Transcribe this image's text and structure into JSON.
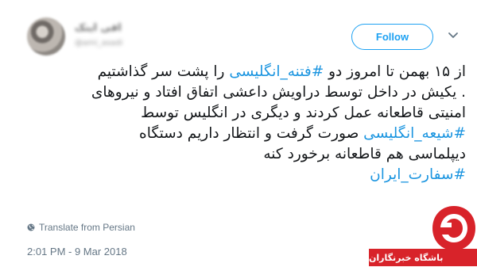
{
  "author": {
    "display_name": "افی اینک",
    "handle": "@ami_asadi",
    "avatar_icon": "user-avatar"
  },
  "header": {
    "follow_label": "Follow",
    "more_icon": "chevron-down-icon"
  },
  "tweet": {
    "line1_pre": "از ۱۵ بهمن تا امروز دو ",
    "line1_tag": "#فتنه_انگلیسی",
    "line1_post": " را پشت سر گذاشتیم",
    "line2": ". یکیش در داخل توسط دراویش داعشی اتفاق افتاد و نیروهای",
    "line3": "امنیتی قاطعانه عمل کردند و دیگری در انگلیس توسط",
    "line4_tag": "#شیعه_انگلیسی",
    "line4_post": " صورت گرفت و انتظار داریم دستگاه",
    "line5": "دیپلماسی هم قاطعانه برخورد کنه",
    "line6_tag": "#سفارت_ایران"
  },
  "translate": {
    "label": "Translate from Persian",
    "icon": "globe-icon"
  },
  "timestamp": "2:01 PM - 9 Mar 2018",
  "watermark": {
    "text": "باشگاه خبرنگاران",
    "brand_color": "#d8232a"
  },
  "colors": {
    "accent": "#1da1f2",
    "hashtag": "#1b95e0",
    "text": "#14171a",
    "muted": "#657786"
  }
}
